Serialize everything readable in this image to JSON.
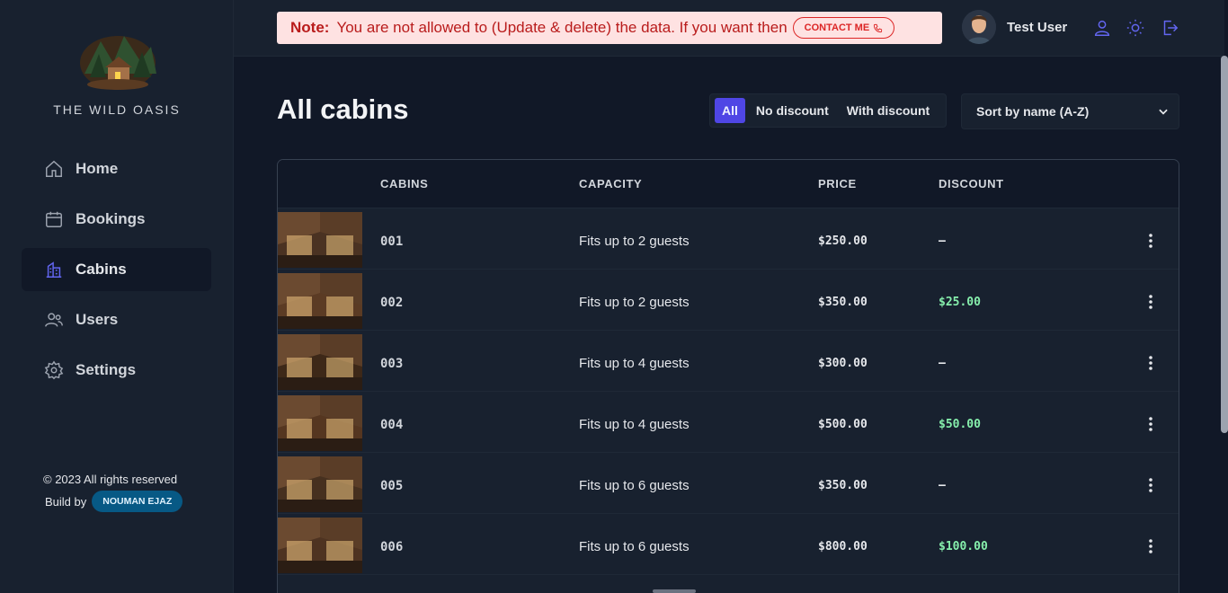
{
  "brand": {
    "name": "THE WILD OASIS"
  },
  "sidebar": {
    "items": [
      {
        "label": "Home",
        "icon": "home-icon"
      },
      {
        "label": "Bookings",
        "icon": "calendar-icon"
      },
      {
        "label": "Cabins",
        "icon": "building-icon",
        "active": true
      },
      {
        "label": "Users",
        "icon": "users-icon"
      },
      {
        "label": "Settings",
        "icon": "gear-icon"
      }
    ],
    "footer": {
      "copyright": "© 2023 All rights reserved",
      "built_by": "Build by",
      "author_badge": "NOUMAN EJAZ"
    }
  },
  "header": {
    "note_label": "Note:",
    "note_text": "You are not allowed to (Update & delete) the data. If you want then",
    "contact_label": "CONTACT ME",
    "user_name": "Test User"
  },
  "main": {
    "title": "All cabins",
    "filters": [
      "All",
      "No discount",
      "With discount"
    ],
    "active_filter": "All",
    "sort_label": "Sort by name (A-Z)"
  },
  "table": {
    "columns": [
      "CABINS",
      "CAPACITY",
      "PRICE",
      "DISCOUNT"
    ],
    "rows": [
      {
        "cabin": "001",
        "capacity": "Fits up to 2 guests",
        "price": "$250.00",
        "discount": "—"
      },
      {
        "cabin": "002",
        "capacity": "Fits up to 2 guests",
        "price": "$350.00",
        "discount": "$25.00"
      },
      {
        "cabin": "003",
        "capacity": "Fits up to 4 guests",
        "price": "$300.00",
        "discount": "—"
      },
      {
        "cabin": "004",
        "capacity": "Fits up to 4 guests",
        "price": "$500.00",
        "discount": "$50.00"
      },
      {
        "cabin": "005",
        "capacity": "Fits up to 6 guests",
        "price": "$350.00",
        "discount": "—"
      },
      {
        "cabin": "006",
        "capacity": "Fits up to 6 guests",
        "price": "$800.00",
        "discount": "$100.00"
      }
    ]
  },
  "colors": {
    "accent": "#4f46e5",
    "bg": "#111827",
    "panel": "#18212f",
    "note_bg": "#fee2e2",
    "note_text": "#b91c1c",
    "discount": "#86efac"
  }
}
